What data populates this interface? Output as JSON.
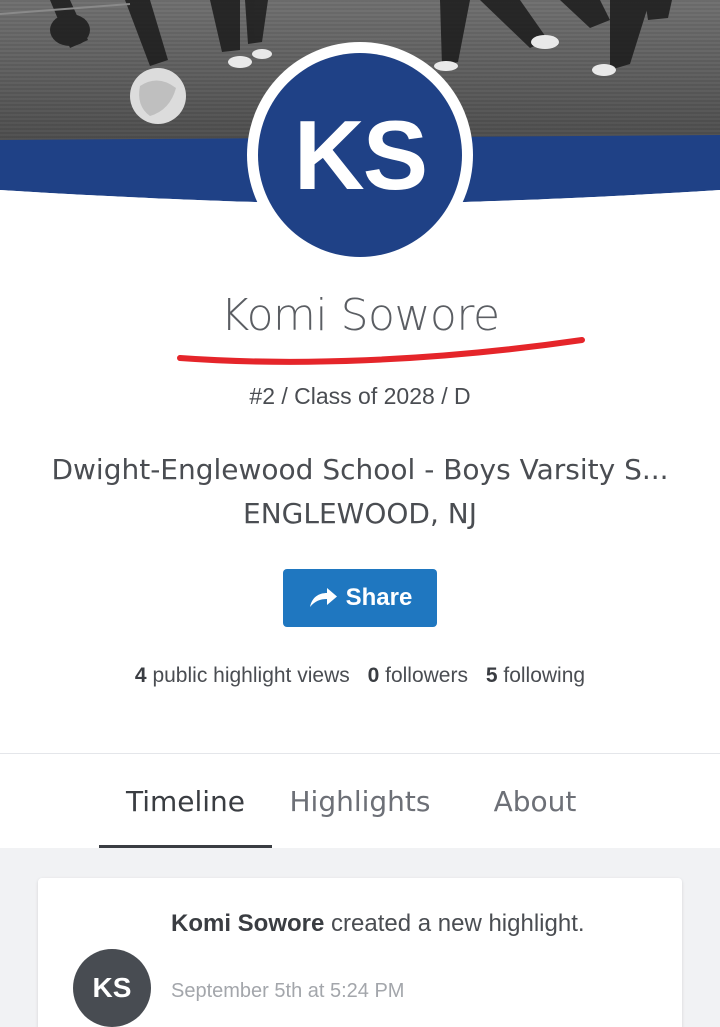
{
  "profile": {
    "initials": "KS",
    "name": "Komi Sowore",
    "meta": "#2 / Class of 2028 / D",
    "school_line1": "Dwight-Englewood School - Boys Varsity S...",
    "school_line2": "ENGLEWOOD, NJ"
  },
  "share": {
    "label": "Share",
    "icon": "share-arrow-icon"
  },
  "stats": [
    {
      "count": "4",
      "label": "public highlight views"
    },
    {
      "count": "0",
      "label": "followers"
    },
    {
      "count": "5",
      "label": "following"
    }
  ],
  "tabs": [
    {
      "label": "Timeline",
      "active": true
    },
    {
      "label": "Highlights",
      "active": false
    },
    {
      "label": "About",
      "active": false
    }
  ],
  "feed": {
    "post": {
      "initials": "KS",
      "author": "Komi Sowore",
      "action": "created a new highlight.",
      "timestamp": "September 5th at 5:24 PM"
    }
  },
  "colors": {
    "brand_blue": "#1f4186",
    "share_blue": "#1f77c0",
    "underline_red": "#e5252a"
  }
}
